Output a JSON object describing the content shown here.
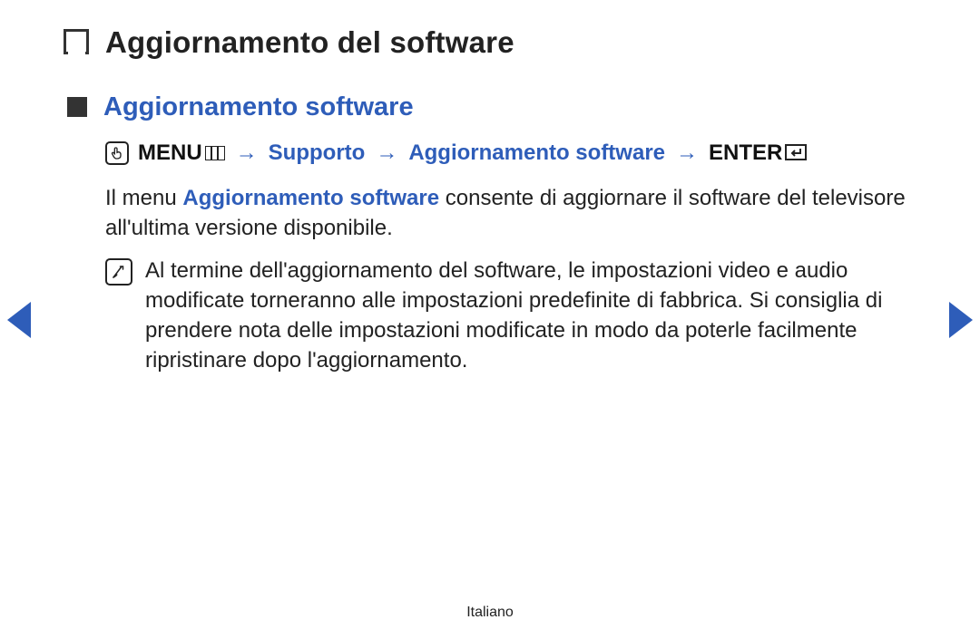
{
  "header": {
    "title": "Aggiornamento del software"
  },
  "section": {
    "title": "Aggiornamento software"
  },
  "path": {
    "menu_label": "MENU",
    "step1": "Supporto",
    "step2": "Aggiornamento software",
    "enter_label": "ENTER",
    "arrow": "→"
  },
  "body": {
    "lead_prefix": "Il menu ",
    "lead_highlight": "Aggiornamento software",
    "lead_suffix": " consente di aggiornare il software del televisore all'ultima versione disponibile."
  },
  "note": {
    "text": "Al termine dell'aggiornamento del software, le impostazioni video e audio modificate torneranno alle impostazioni predefinite di fabbrica. Si consiglia di prendere nota delle impostazioni modificate in modo da poterle facilmente ripristinare dopo l'aggiornamento."
  },
  "footer": {
    "language": "Italiano"
  }
}
